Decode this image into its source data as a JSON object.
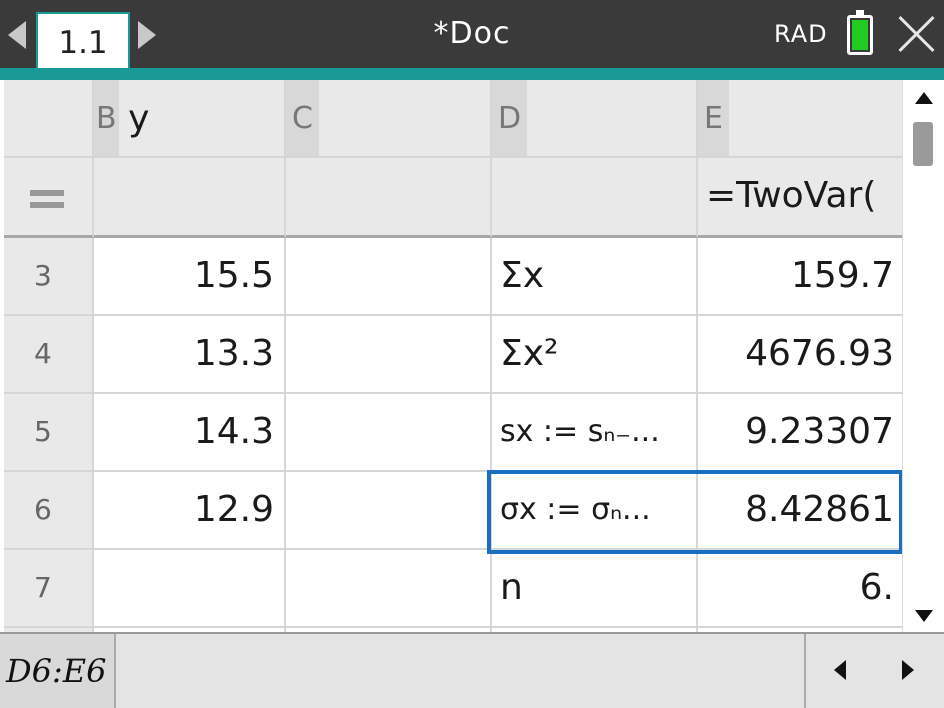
{
  "titlebar": {
    "page_tab": "1.1",
    "doc_title": "*Doc",
    "angle_mode": "RAD",
    "battery_color": "#22cc22",
    "close_icon": "close-icon"
  },
  "columns": {
    "b": "B",
    "b_name": "y",
    "c": "C",
    "d": "D",
    "e": "E",
    "e_formula": "=TwoVar("
  },
  "rows": [
    {
      "num": "3",
      "b": "15.5",
      "d": "Σx",
      "e": "159.7"
    },
    {
      "num": "4",
      "b": "13.3",
      "d": "Σx²",
      "e": "4676.93"
    },
    {
      "num": "5",
      "b": "14.3",
      "d": "sx := sₙ₋...",
      "e": "9.23307"
    },
    {
      "num": "6",
      "b": "12.9",
      "d": "σx := σₙ...",
      "e": "8.42861"
    },
    {
      "num": "7",
      "b": "",
      "d": "n",
      "e": "6."
    }
  ],
  "bottombar": {
    "cell_reference": "D6:E6",
    "entry_value": ""
  },
  "colors": {
    "titlebar": "#3a3a3a",
    "accent": "#1a9a96",
    "selection": "#1a6fc0"
  }
}
